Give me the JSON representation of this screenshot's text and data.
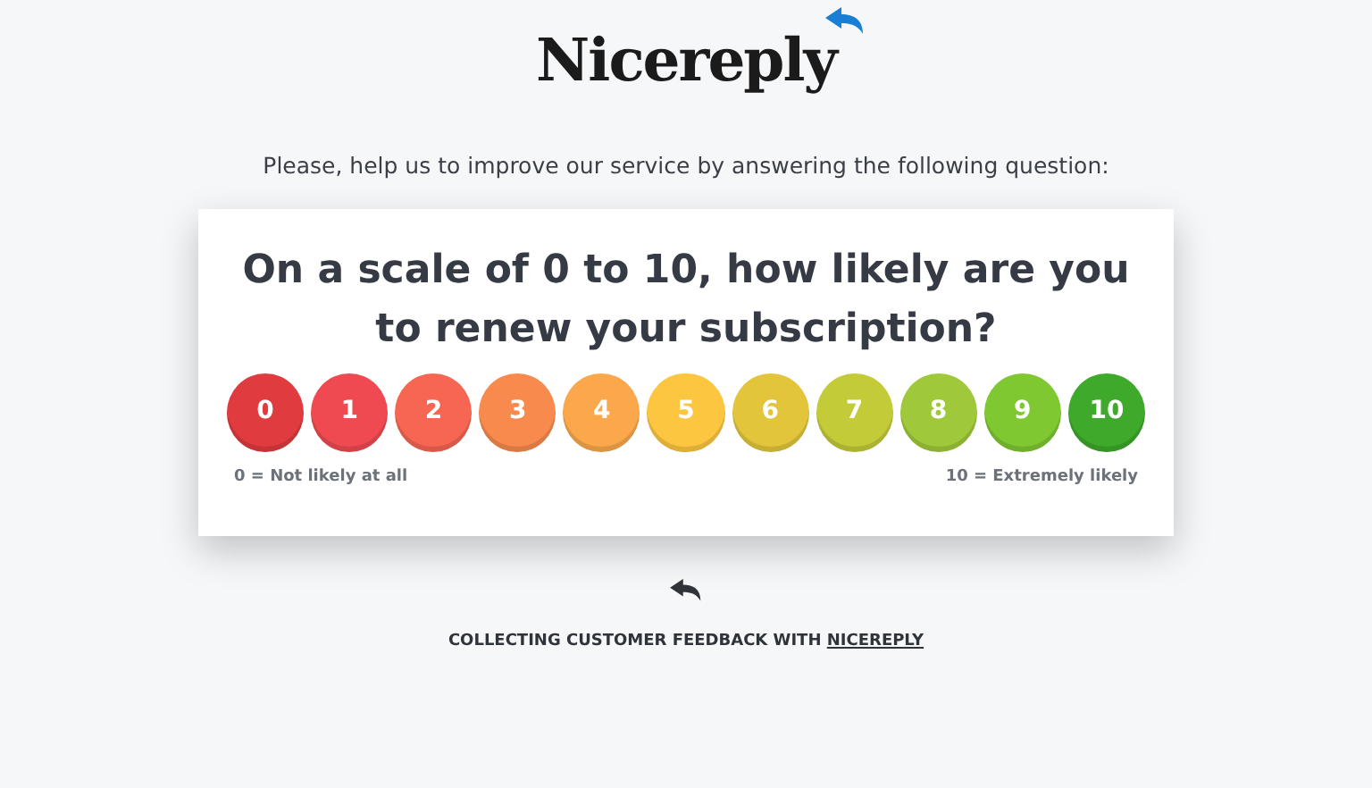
{
  "logo": {
    "text": "Nicereply"
  },
  "intro": "Please, help us to improve our service by answering the following question:",
  "question": "On a scale of 0 to 10, how likely are you to renew your subscription?",
  "scale": [
    {
      "label": "0",
      "color": "#e03c3f"
    },
    {
      "label": "1",
      "color": "#ef4a52"
    },
    {
      "label": "2",
      "color": "#f76652"
    },
    {
      "label": "3",
      "color": "#f88a4e"
    },
    {
      "label": "4",
      "color": "#fba84c"
    },
    {
      "label": "5",
      "color": "#fdc640"
    },
    {
      "label": "6",
      "color": "#e2c53b"
    },
    {
      "label": "7",
      "color": "#c3cb38"
    },
    {
      "label": "8",
      "color": "#9fc93a"
    },
    {
      "label": "9",
      "color": "#7fc832"
    },
    {
      "label": "10",
      "color": "#3ea92a"
    }
  ],
  "low_label": "0 = Not likely at all",
  "high_label": "10 = Extremely likely",
  "footer": {
    "text": "COLLECTING CUSTOMER FEEDBACK WITH",
    "link": "NICEREPLY"
  }
}
